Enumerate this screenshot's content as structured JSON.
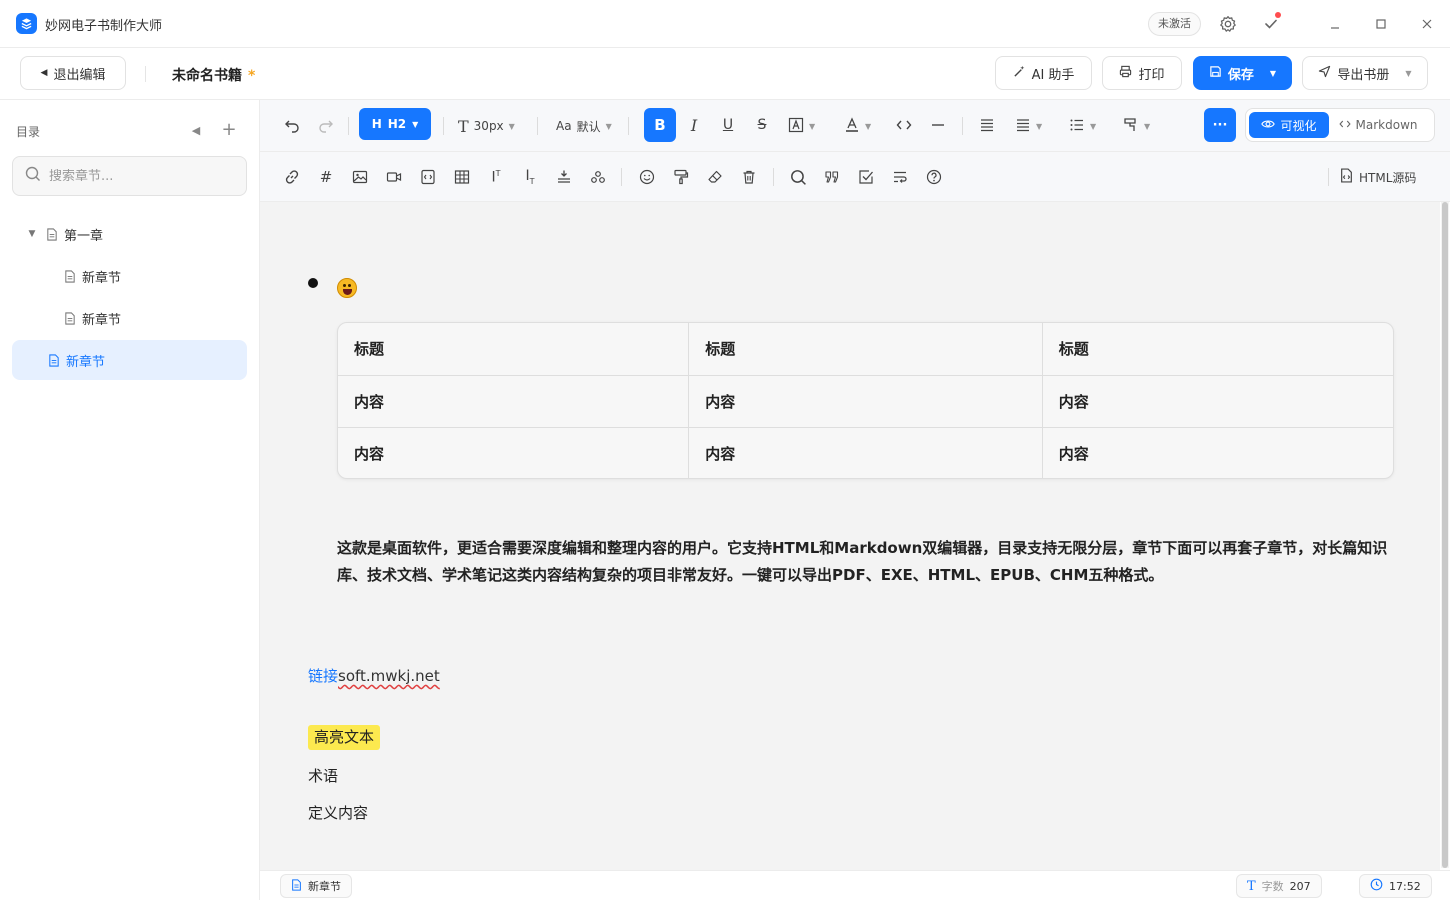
{
  "app": {
    "title": "妙网电子书制作大师",
    "status_badge": "未激活"
  },
  "actionbar": {
    "exit_label": "退出编辑",
    "book_title": "未命名书籍",
    "unsaved_mark": "*",
    "ai_label": "AI 助手",
    "print_label": "打印",
    "save_label": "保存",
    "export_label": "导出书册"
  },
  "sidebar": {
    "heading": "目录",
    "search_placeholder": "搜索章节...",
    "items": [
      {
        "label": "第一章",
        "level": 0,
        "expanded": true
      },
      {
        "label": "新章节",
        "level": 1
      },
      {
        "label": "新章节",
        "level": 1
      },
      {
        "label": "新章节",
        "level": 0,
        "active": true
      }
    ]
  },
  "toolbar": {
    "heading_level": "H2",
    "font_size": "30px",
    "font_family": "默认",
    "visual_label": "可视化",
    "markdown_label": "Markdown",
    "html_source_label": "HTML源码"
  },
  "editor": {
    "table": {
      "header": [
        "标题",
        "标题",
        "标题"
      ],
      "rows": [
        [
          "内容",
          "内容",
          "内容"
        ],
        [
          "内容",
          "内容",
          "内容"
        ]
      ]
    },
    "paragraph": "这款是桌面软件，更适合需要深度编辑和整理内容的用户。它支持HTML和Markdown双编辑器，目录支持无限分层，章节下面可以再套子章节，对长篇知识库、技术文档、学术笔记这类内容结构复杂的项目非常友好。一键可以导出PDF、EXE、HTML、EPUB、CHM五种格式。",
    "link_label": "链接",
    "link_url": "soft.mwkj.net",
    "highlight_text": "高亮文本",
    "term": "术语",
    "definition": "定义内容"
  },
  "statusbar": {
    "current_chapter": "新章节",
    "word_count_label": "字数",
    "word_count": "207",
    "time": "17:52"
  },
  "colors": {
    "accent": "#1677ff",
    "highlight": "#fce94f",
    "unsaved_star": "#f5a623"
  }
}
